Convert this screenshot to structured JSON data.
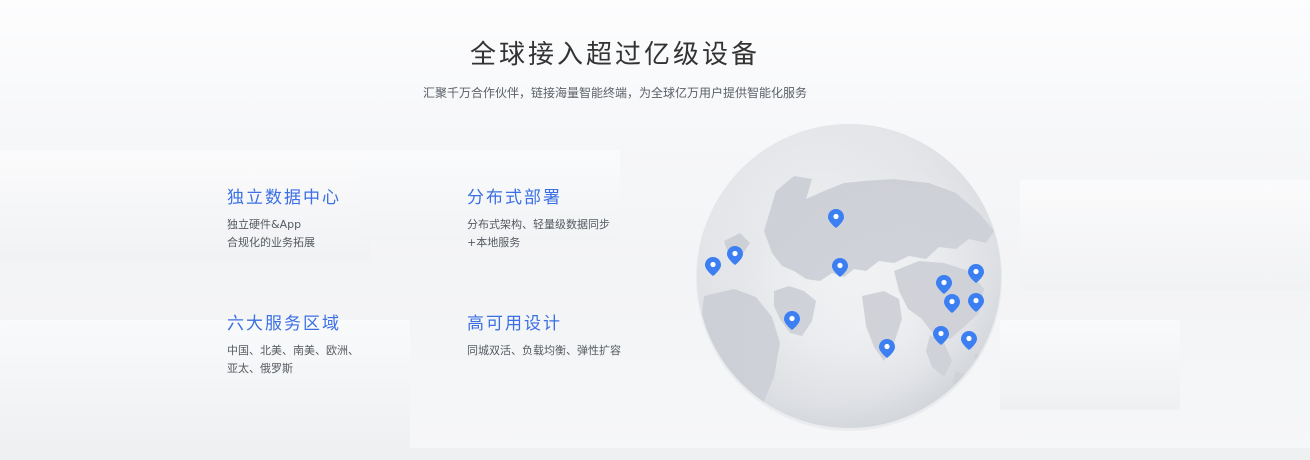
{
  "header": {
    "title": "全球接入超过亿级设备",
    "subtitle": "汇聚千万合作伙伴，链接海量智能终端，为全球亿万用户提供智能化服务"
  },
  "features": [
    {
      "title": "独立数据中心",
      "lines": [
        "独立硬件&App",
        "合规化的业务拓展"
      ]
    },
    {
      "title": "分布式部署",
      "lines": [
        "分布式架构、轻量级数据同步",
        "+本地服务"
      ]
    },
    {
      "title": "六大服务区域",
      "lines": [
        "中国、北美、南美、欧洲、",
        "亚太、俄罗斯"
      ]
    },
    {
      "title": "高可用设计",
      "lines": [
        "同城双活、负载均衡、弹性扩容"
      ]
    }
  ],
  "globe": {
    "pin_icon": "location-pin-icon",
    "pin_color": "#3b7ff2",
    "pin_count": 12
  },
  "colors": {
    "accent": "#3b6fe3",
    "title": "#333333",
    "body": "#555a60"
  }
}
